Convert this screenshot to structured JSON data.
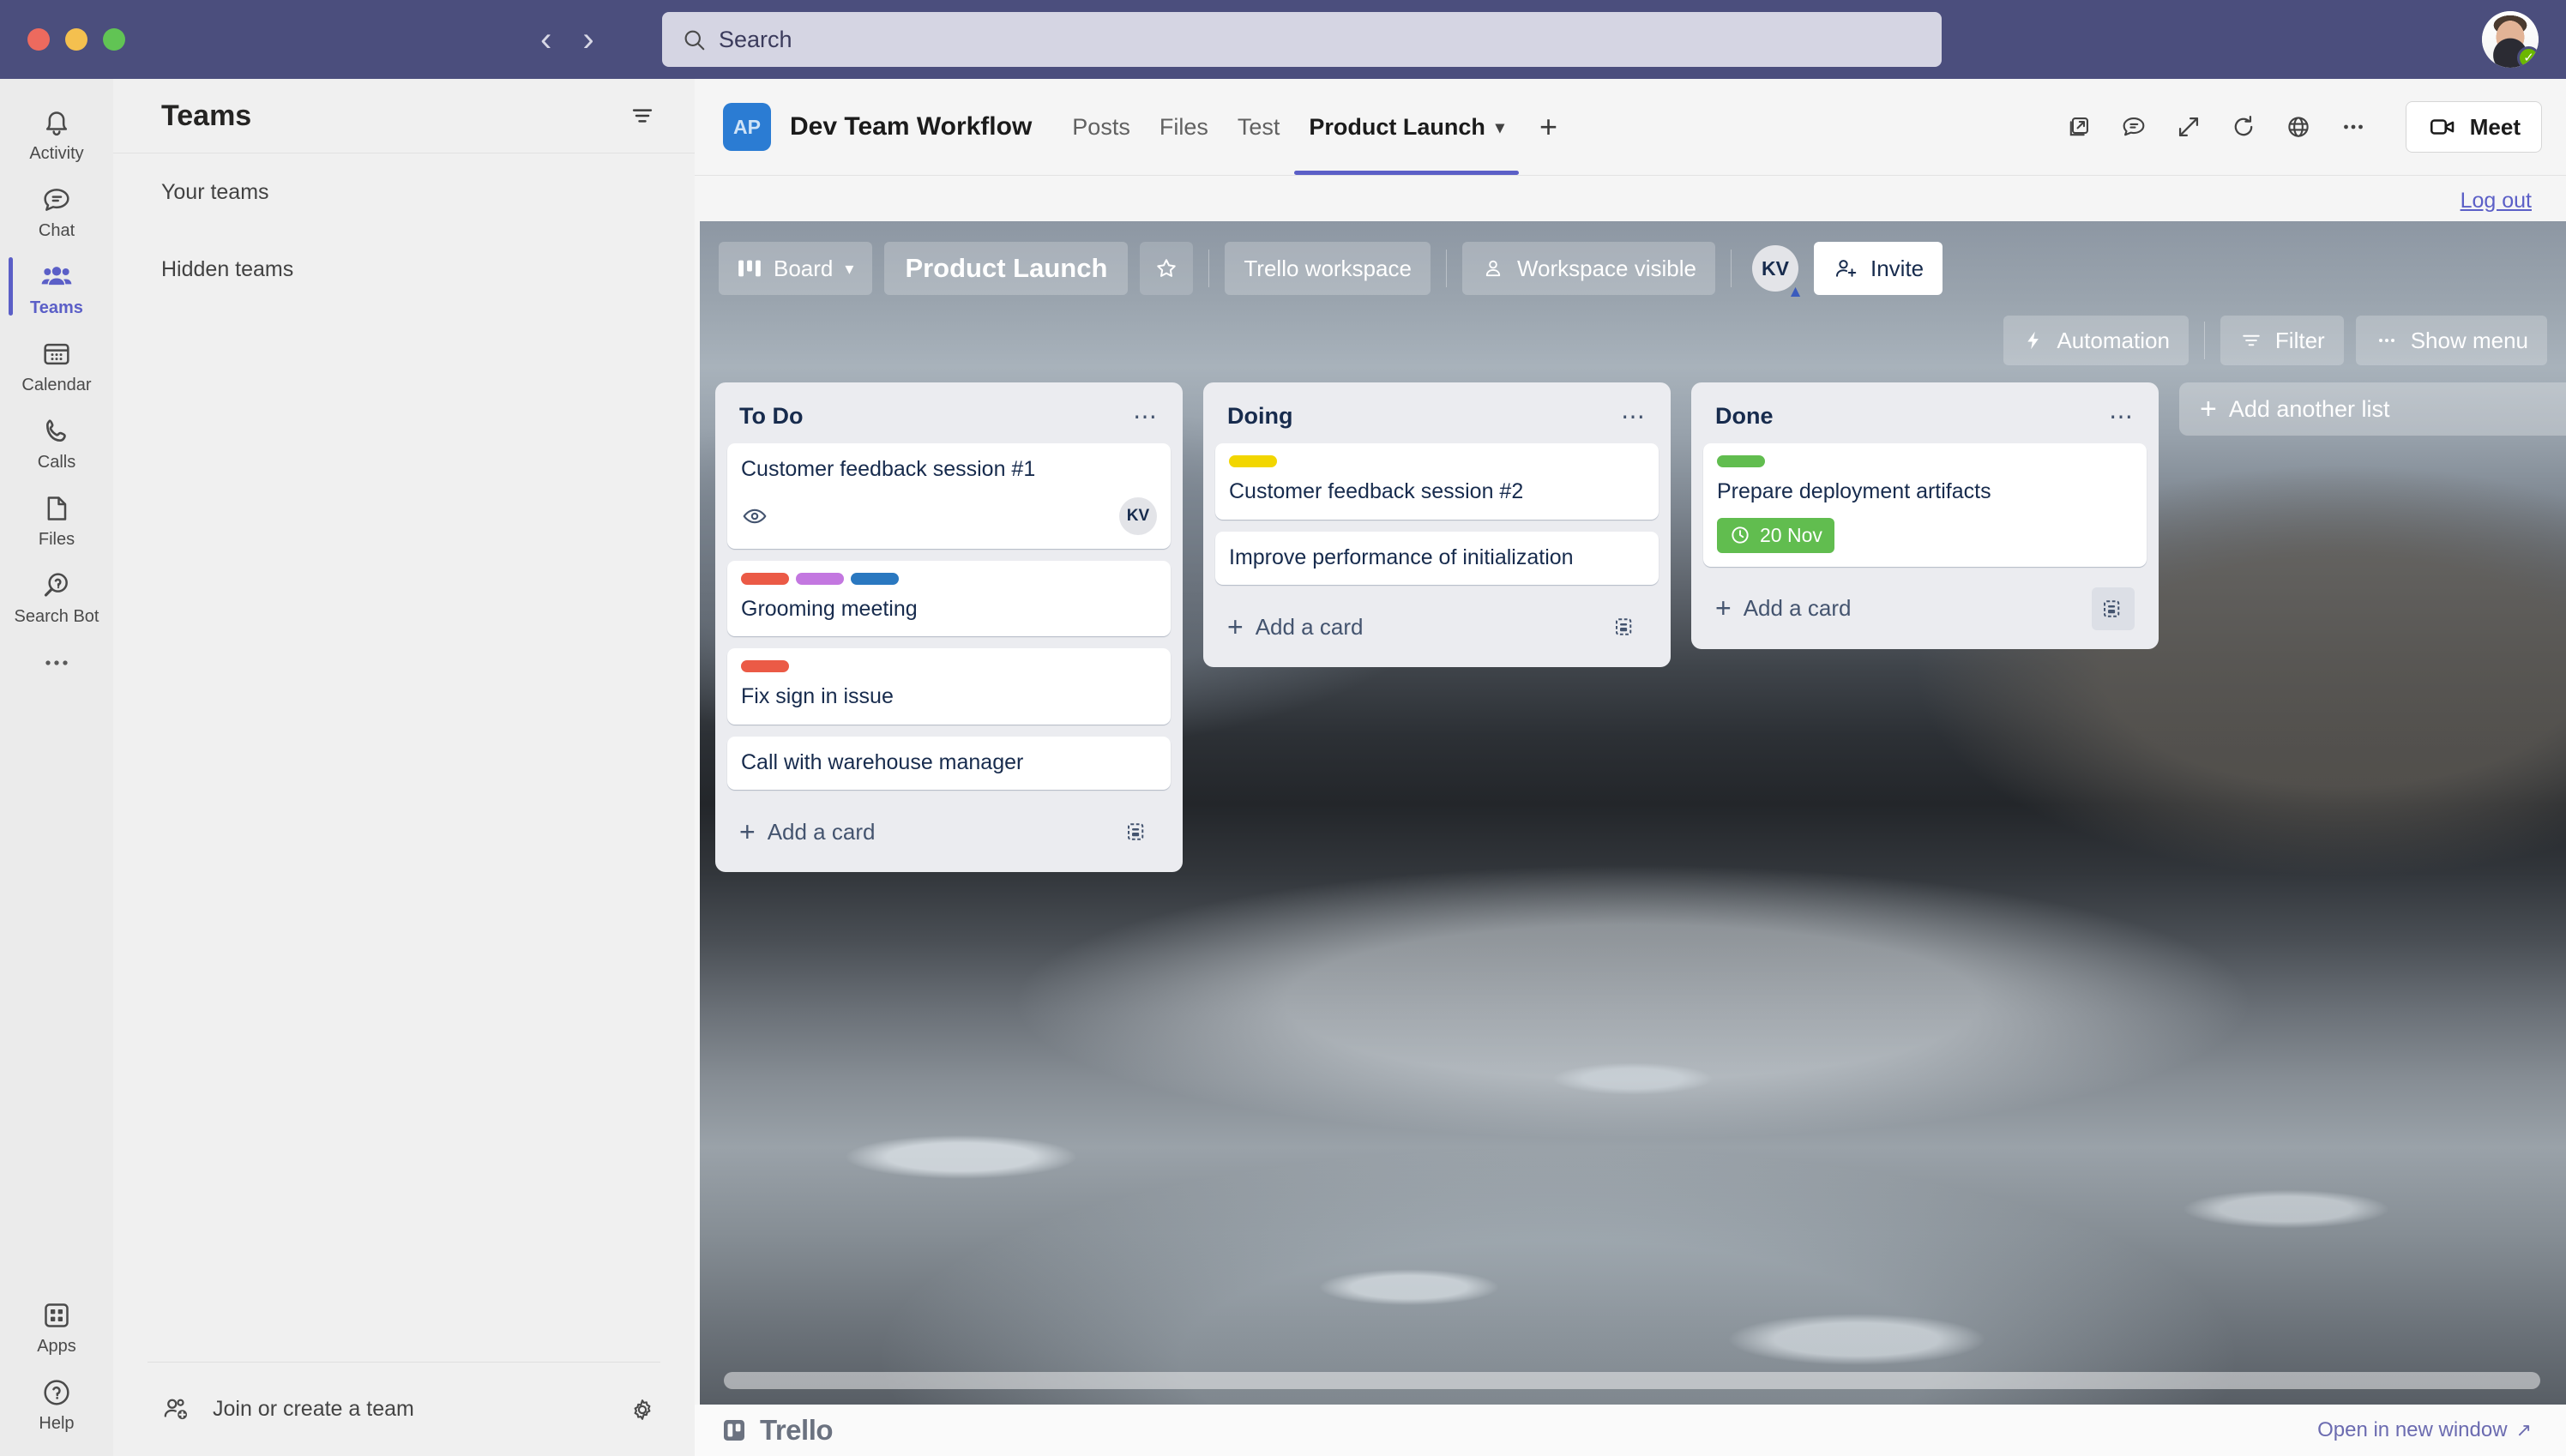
{
  "window": {
    "traffic_lights": [
      "close",
      "minimize",
      "maximize"
    ]
  },
  "topbar": {
    "back_icon": "chevron-left-icon",
    "forward_icon": "chevron-right-icon",
    "search": {
      "icon": "search-icon",
      "placeholder": "Search",
      "value": ""
    },
    "profile": {
      "name": "avatar",
      "presence": "available"
    }
  },
  "rail": {
    "items": [
      {
        "label": "Activity",
        "icon": "bell-icon",
        "active": false
      },
      {
        "label": "Chat",
        "icon": "chat-icon",
        "active": false
      },
      {
        "label": "Teams",
        "icon": "teams-icon",
        "active": true
      },
      {
        "label": "Calendar",
        "icon": "calendar-icon",
        "active": false
      },
      {
        "label": "Calls",
        "icon": "phone-icon",
        "active": false
      },
      {
        "label": "Files",
        "icon": "file-icon",
        "active": false
      },
      {
        "label": "Search Bot",
        "icon": "search-bot-icon",
        "active": false
      },
      {
        "label": "",
        "icon": "more-icon",
        "active": false
      }
    ],
    "bottom": [
      {
        "label": "Apps",
        "icon": "apps-icon"
      },
      {
        "label": "Help",
        "icon": "help-icon"
      }
    ]
  },
  "teams_panel": {
    "title": "Teams",
    "filter_icon": "filter-icon",
    "items": [
      {
        "label": "Your teams"
      },
      {
        "label": "Hidden teams"
      }
    ],
    "footer": {
      "label": "Join or create a team",
      "icon": "person-add-icon",
      "settings_icon": "gear-icon"
    }
  },
  "app_header": {
    "team_initials": "AP",
    "team_name": "Dev Team Workflow",
    "tabs": [
      {
        "label": "Posts",
        "active": false,
        "has_chevron": false
      },
      {
        "label": "Files",
        "active": false,
        "has_chevron": false
      },
      {
        "label": "Test",
        "active": false,
        "has_chevron": false
      },
      {
        "label": "Product Launch",
        "active": true,
        "has_chevron": true
      }
    ],
    "add_tab_label": "+",
    "actions": [
      {
        "name": "pop-out-icon"
      },
      {
        "name": "conversation-icon"
      },
      {
        "name": "expand-icon"
      },
      {
        "name": "refresh-icon"
      },
      {
        "name": "globe-icon"
      },
      {
        "name": "more-options-icon"
      }
    ],
    "meet_button": {
      "label": "Meet",
      "icon": "video-camera-icon"
    },
    "logout_label": "Log out"
  },
  "board": {
    "view_button": {
      "label": "Board",
      "icon": "board-view-icon",
      "chevron": "chevron-down-icon"
    },
    "title": "Product Launch",
    "star_icon": "star-icon",
    "workspace_label": "Trello workspace",
    "visibility_label": "Workspace visible",
    "visibility_icon": "person-icon",
    "member_initials": "KV",
    "invite_button": {
      "label": "Invite",
      "icon": "person-add-icon"
    },
    "automation_button": {
      "label": "Automation",
      "icon": "bolt-icon"
    },
    "filter_button": {
      "label": "Filter",
      "icon": "filter-icon"
    },
    "show_menu_button": {
      "label": "Show menu",
      "icon": "ellipsis-icon"
    },
    "add_list_label": "Add another list",
    "add_card_label": "Add a card",
    "card_template_icon": "card-template-icon",
    "list_menu_icon": "list-menu-icon",
    "lists": [
      {
        "name": "To Do",
        "cards": [
          {
            "title": "Customer feedback session #1",
            "labels": [],
            "watch_icon": "eye-icon",
            "members": [
              "KV"
            ],
            "due": null
          },
          {
            "title": "Grooming meeting",
            "labels": [
              "#eb5a46",
              "#c377e0",
              "#2a78c0"
            ],
            "watch_icon": null,
            "members": [],
            "due": null
          },
          {
            "title": "Fix sign in issue",
            "labels": [
              "#eb5a46"
            ],
            "watch_icon": null,
            "members": [],
            "due": null
          },
          {
            "title": "Call with warehouse manager",
            "labels": [],
            "watch_icon": null,
            "members": [],
            "due": null
          }
        ]
      },
      {
        "name": "Doing",
        "cards": [
          {
            "title": "Customer feedback session #2",
            "labels": [
              "#f2d600"
            ],
            "watch_icon": null,
            "members": [],
            "due": null
          },
          {
            "title": "Improve performance of initialization",
            "labels": [],
            "watch_icon": null,
            "members": [],
            "due": null
          }
        ]
      },
      {
        "name": "Done",
        "cards": [
          {
            "title": "Prepare deployment artifacts",
            "labels": [
              "#61bd4f"
            ],
            "watch_icon": null,
            "members": [],
            "due": {
              "text": "20 Nov",
              "icon": "clock-icon",
              "color": "#61bd4f"
            }
          }
        ]
      }
    ]
  },
  "trello_footer": {
    "name": "Trello",
    "logo_icon": "trello-logo-icon",
    "open_label": "Open in new window",
    "open_icon": "external-link-icon"
  },
  "colors": {
    "teams_purple": "#4b4e7d",
    "accent": "#5b5fc7",
    "trello_green": "#61bd4f"
  }
}
